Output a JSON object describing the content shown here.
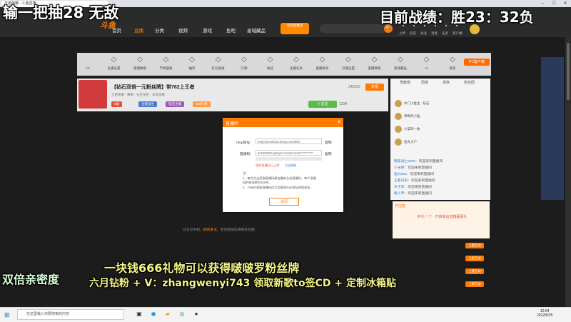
{
  "browser": {
    "tab_title": "王者荣耀 - 斗鱼直播",
    "min": "–",
    "max": "☐",
    "close": "✕"
  },
  "site": {
    "logo": "斗鱼",
    "nav": [
      "首页",
      "直播",
      "分类",
      "视频",
      "游戏",
      "鱼吧",
      "星城藏品"
    ],
    "promo": "全民星推官",
    "search_button": "🔍",
    "top_icons": [
      {
        "icon": "upload-icon",
        "label": "上传"
      },
      {
        "icon": "history-icon",
        "label": "历史"
      },
      {
        "icon": "follow-icon",
        "label": "关注"
      },
      {
        "icon": "message-icon",
        "label": "消息"
      },
      {
        "icon": "task-icon",
        "label": "任务"
      },
      {
        "icon": "download-icon",
        "label": "客户端"
      }
    ]
  },
  "toolbar": {
    "items": [
      {
        "label": "12",
        "sub": "已播时长"
      },
      {
        "label": "主播设置",
        "sub": ""
      },
      {
        "label": "直播数据",
        "sub": ""
      },
      {
        "label": "节奏面板",
        "sub": ""
      },
      {
        "label": "抽奖",
        "sub": ""
      },
      {
        "label": "红包发放",
        "sub": ""
      },
      {
        "label": "礼物",
        "sub": ""
      },
      {
        "label": "粉丝",
        "sub": ""
      },
      {
        "label": "主播任务",
        "sub": ""
      },
      {
        "label": "直播助手",
        "sub": ""
      },
      {
        "label": "开播设置",
        "sub": ""
      },
      {
        "label": "直播教程",
        "sub": ""
      },
      {
        "label": "星城藏品",
        "sub": ""
      },
      {
        "label": "AI",
        "sub": ""
      },
      {
        "label": "更多",
        "sub": ""
      }
    ],
    "pc_button": "PC客户端"
  },
  "stream": {
    "title": "【钻石双倍一元粉丝牌】带762上王者",
    "meta": "王者荣耀 · 赛事 · 分区排名 · 本周贡献",
    "tags": [
      {
        "text": "5级",
        "color": "#e74c3c"
      },
      {
        "text": "全能战士",
        "color": "#4a7bd0"
      },
      {
        "text": "钻石主播",
        "color": "#9b59b6"
      },
      {
        "text": "666礼物",
        "color": "#ff9a3c"
      }
    ],
    "follow": "＋关注",
    "follow_count": "1234",
    "popularity": "249502",
    "report": "举报",
    "offline_prefix": "信号已中断，",
    "offline_link": "刷新重试",
    "offline_suffix": "，若问题依旧请联系客服"
  },
  "modal": {
    "title": "直播码",
    "close": "✕",
    "rtmp_label": "rtmp地址：",
    "rtmp_value": "rtmp://sendtc3a.douyu.com/live",
    "key_label": "直播码：",
    "key_value": "5115879rKeyDguru7so3ecretsr***********",
    "copy": "复制",
    "warn": "您的直播码已上传",
    "warn_link": "点击刷新",
    "notes": [
      "注：",
      "1、每次点击获取直播码都会重新生成直播码，每个直播",
      "   码的有效期为3分钟。",
      "2、只有在获取直播码后才会看到rtmp地址改变变化。"
    ],
    "ok": "关闭"
  },
  "rank": {
    "tabs": [
      "贡献榜",
      "周榜",
      "贵族",
      "粉丝团"
    ],
    "rows": [
      "水门小金主 · 钻石",
      "神奇的小鱼",
      "小菜鸡一枚",
      "鱼丸大户"
    ],
    "messages": [
      {
        "user": "暗黑骑士8888：",
        "text": "欢迎来到直播间"
      },
      {
        "user": "小米粥：",
        "text": "欢迎来到直播间"
      },
      {
        "user": "鱼丸666：",
        "text": "欢迎来到直播间"
      },
      {
        "user": "王者归来：",
        "text": "欢迎来到直播间"
      },
      {
        "user": "木子李：",
        "text": "欢迎来到直播间"
      },
      {
        "user": "路人甲：",
        "text": "欢迎来到直播间"
      }
    ]
  },
  "gift": {
    "title": "开宝箱",
    "body": "好礼一个 · 开启幸运宝箱赢豪礼",
    "up_buttons": [
      "上麦互动",
      "上麦互动",
      "上麦互动",
      "上麦互动"
    ]
  },
  "taskbar": {
    "start": "⊞",
    "search_placeholder": "在这里输入你要搜索的内容",
    "time": "12:04",
    "date": "2022/6/25"
  },
  "overlay": {
    "top_left": "输一把抽28 无敌",
    "top_right": "目前战绩：胜23：32负",
    "mid": "一块钱666礼物可以获得啵啵罗粉丝牌",
    "left_bottom": "双倍亲密度",
    "bottom": "六月钻粉 + V：zhangwenyi743 领取新歌to签CD + 定制冰箱贴"
  },
  "colors": {
    "accent": "#ff7a00",
    "overlay_yellow": "#f5f589"
  }
}
